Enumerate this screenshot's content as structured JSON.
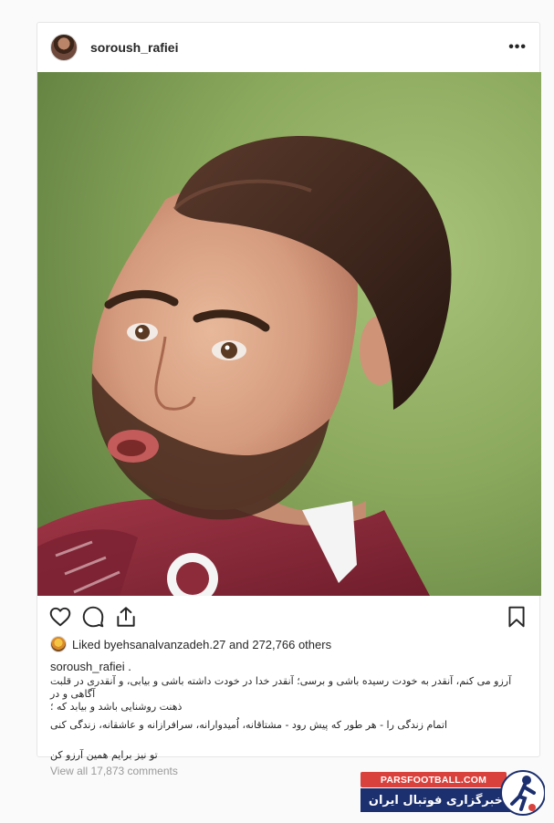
{
  "post": {
    "username": "soroush_rafiei",
    "more_icon": "more-horizontal-icon"
  },
  "actions": {
    "like_icon": "heart-icon",
    "comment_icon": "comment-icon",
    "share_icon": "share-icon",
    "save_icon": "bookmark-icon"
  },
  "likes": {
    "prefix": "Liked by ",
    "liker": "ehsanalvanzadeh.27",
    "suffix": " and 272,766 others"
  },
  "caption": {
    "username": "soroush_rafiei .",
    "line1": "آرزو می کنم، آنقدر به خودت رسیده باشی و برسی؛ آنقدر خدا در خودت داشته باشی و بیابی، و آنقدری در قلبت آگاهی و در",
    "line2": "ذهنت روشنایی باشد و بیابد که ؛",
    "line3": "اتمام زندگی را - هر طور که پیش رود -  مشتاقانه، اُمیدوارانه، سرافرازانه و عاشقانه، زندگی کنی",
    "line4": "تو نیز برایم همین آرزو کن"
  },
  "comments": {
    "view_all": "View all 17,873 comments"
  },
  "watermark": {
    "site": "PARSFOOTBALL.COM",
    "name": "خبرگزاری فوتبال ایران"
  },
  "colors": {
    "watermark_red": "#d9413c",
    "watermark_blue": "#1c2f6e",
    "jersey": "#8e2b3a"
  }
}
